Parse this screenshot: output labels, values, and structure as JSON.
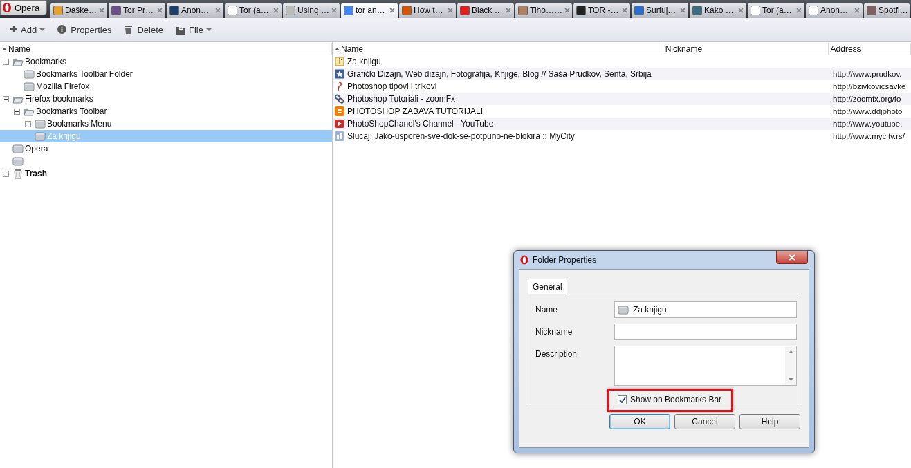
{
  "tabs": {
    "menu_button": {
      "label": "Opera"
    },
    "items": [
      {
        "label": "Daške…",
        "selected": false
      },
      {
        "label": "Tor Pr…",
        "selected": false
      },
      {
        "label": "Anon…",
        "selected": false
      },
      {
        "label": "Tor (a…",
        "selected": false
      },
      {
        "label": "Using …",
        "selected": false
      },
      {
        "label": "tor an…",
        "selected": true
      },
      {
        "label": "How t…",
        "selected": false
      },
      {
        "label": "Black …",
        "selected": false
      },
      {
        "label": "Tiho……",
        "selected": false
      },
      {
        "label": "TOR -…",
        "selected": false
      },
      {
        "label": "Surfuj…",
        "selected": false
      },
      {
        "label": "Kako …",
        "selected": false
      },
      {
        "label": "Tor (a…",
        "selected": false
      },
      {
        "label": "Anon…",
        "selected": false
      },
      {
        "label": "Spotfl…",
        "selected": false
      }
    ]
  },
  "toolbar": [
    {
      "label": "Add",
      "kind": "add",
      "menu": true
    },
    {
      "label": "Properties",
      "kind": "info",
      "menu": false
    },
    {
      "label": "Delete",
      "kind": "delete",
      "menu": false
    },
    {
      "label": "File",
      "kind": "file",
      "menu": true
    }
  ],
  "tree": {
    "columns": [
      {
        "label": "Name",
        "sorted": true
      }
    ],
    "items": [
      {
        "label": "Bookmarks",
        "kind": "folder",
        "expanded": true,
        "selected": false,
        "children": [
          {
            "label": "Bookmarks Toolbar Folder",
            "kind": "folder",
            "selected": false
          },
          {
            "label": "Mozilla Firefox",
            "kind": "folder",
            "selected": false
          }
        ]
      },
      {
        "label": "Firefox bookmarks",
        "kind": "folder",
        "expanded": true,
        "selected": false,
        "children": [
          {
            "label": "Bookmarks Toolbar",
            "kind": "folder",
            "expanded": true,
            "selected": false,
            "children": [
              {
                "label": "Bookmarks Menu",
                "kind": "folder",
                "expanded": false,
                "selected": false
              },
              {
                "label": "Za knjigu",
                "kind": "folder",
                "selected": true
              }
            ]
          }
        ]
      },
      {
        "label": "Opera",
        "kind": "folder",
        "selected": false
      },
      {
        "kind": "folder",
        "selected": false
      },
      {
        "label": "Trash",
        "kind": "trash",
        "expanded": false,
        "selected": false
      }
    ]
  },
  "list": {
    "columns": [
      {
        "label": "Name",
        "sorted": true
      },
      {
        "label": "Nickname",
        "sorted": false
      },
      {
        "label": "Address",
        "sorted": false
      }
    ],
    "rows": [
      {
        "name": "Za knjigu",
        "kind": "folder"
      },
      {
        "name": "Grafički Dizajn, Web dizajn, Fotografija, Knjige, Blog // Saša Prudkov, Senta, Srbija",
        "address": "http://www.prudkov.",
        "kind": "star"
      },
      {
        "name": "Photoshop tipovi i trikovi",
        "address": "http://bzivkovicsavke",
        "kind": "pin"
      },
      {
        "name": "Photoshop Tutoriali - zoomFx",
        "address": "http://zoomfx.org/fo",
        "kind": "link"
      },
      {
        "name": "PHOTOSHOP ZABAVA TUTORIJALI",
        "address": "http://www.ddjphoto",
        "kind": "blog"
      },
      {
        "name": "PhotoShopChanel's Channel - YouTube",
        "address": "http://www.youtube.",
        "kind": "video"
      },
      {
        "name": "Slucaj: Jako-usporen-sve-dok-se-potpuno-ne-blokira :: MyCity",
        "address": "http://www.mycity.rs/",
        "kind": "city"
      }
    ]
  },
  "dialog": {
    "title": "Folder Properties",
    "tabs": [
      {
        "label": "General",
        "selected": true
      }
    ],
    "fields": [
      {
        "label": "Name",
        "value": "Za knjigu",
        "kind": "folder"
      },
      {
        "label": "Nickname",
        "kind": "text"
      },
      {
        "label": "Description",
        "kind": "multiline"
      }
    ],
    "checkbox": {
      "label": "Show on Bookmarks Bar",
      "checked": true,
      "highlighted": true
    },
    "buttons": [
      {
        "label": "OK",
        "default": true
      },
      {
        "label": "Cancel",
        "default": false
      },
      {
        "label": "Help",
        "default": false
      }
    ]
  }
}
